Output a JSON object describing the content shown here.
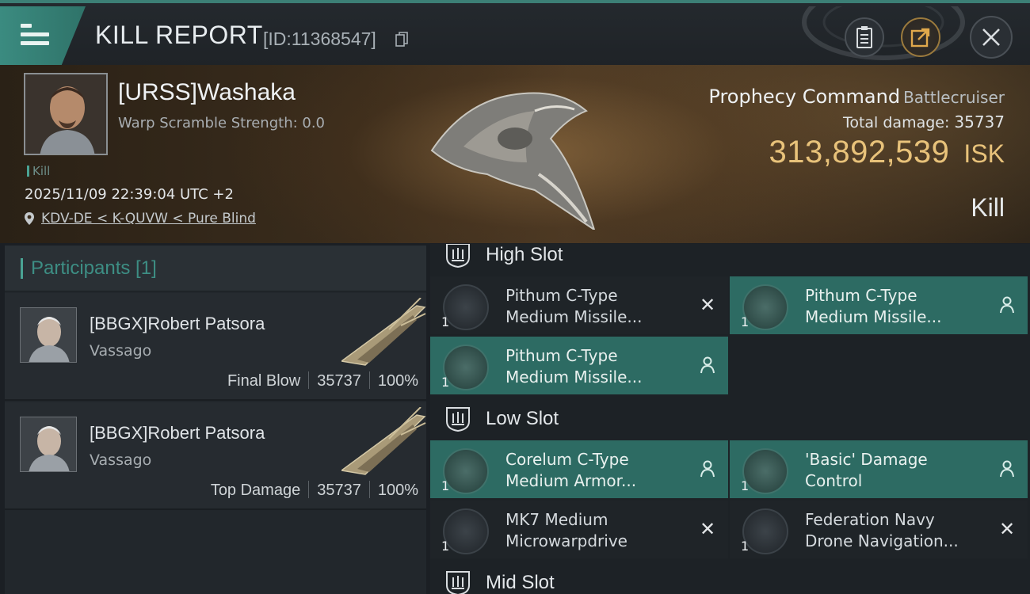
{
  "header": {
    "title": "KILL REPORT",
    "report_id": "[ID:11368547]",
    "icons": [
      "menu-icon",
      "copy-icon",
      "clipboard-icon",
      "share-icon",
      "close-icon"
    ]
  },
  "victim": {
    "name": "[URSS]Washaka",
    "warp_scramble": "Warp Scramble Strength: 0.0",
    "tag": "Kill",
    "datetime": "2025/11/09 22:39:04 UTC +2",
    "location": "KDV-DE < K-QUVW < Pure Blind",
    "ship_name": "Prophecy Command",
    "ship_class": "Battlecruiser",
    "total_damage_label": "Total damage:",
    "total_damage": "35737",
    "isk_value": "313,892,539",
    "isk_unit": "ISK",
    "result": "Kill"
  },
  "participants": {
    "title": "Participants [1]",
    "rows": [
      {
        "name": "[BBGX]Robert Patsora",
        "ship": "Vassago",
        "role": "Final Blow",
        "damage": "35737",
        "percent": "100%"
      },
      {
        "name": "[BBGX]Robert Patsora",
        "ship": "Vassago",
        "role": "Top Damage",
        "damage": "35737",
        "percent": "100%"
      }
    ]
  },
  "slots": {
    "high": {
      "title": "High Slot",
      "modules": [
        {
          "line1": "Pithum C-Type",
          "line2": "Medium Missile...",
          "qty": "1",
          "state": "destroyed"
        },
        {
          "line1": "Pithum C-Type",
          "line2": "Medium Missile...",
          "qty": "1",
          "state": "dropped"
        },
        {
          "line1": "Pithum C-Type",
          "line2": "Medium Missile...",
          "qty": "1",
          "state": "dropped"
        }
      ]
    },
    "low": {
      "title": "Low Slot",
      "modules": [
        {
          "line1": "Corelum C-Type",
          "line2": "Medium Armor...",
          "qty": "1",
          "state": "dropped"
        },
        {
          "line1": "'Basic' Damage",
          "line2": "Control",
          "qty": "1",
          "state": "dropped"
        },
        {
          "line1": "MK7 Medium",
          "line2": "Microwarpdrive",
          "qty": "1",
          "state": "destroyed"
        },
        {
          "line1": "Federation Navy",
          "line2": "Drone Navigation...",
          "qty": "1",
          "state": "destroyed"
        }
      ]
    },
    "mid": {
      "title": "Mid Slot"
    }
  },
  "colors": {
    "accent_teal": "#3b8b80",
    "module_active": "#2d6b63",
    "isk_gold": "#e8c27a"
  }
}
